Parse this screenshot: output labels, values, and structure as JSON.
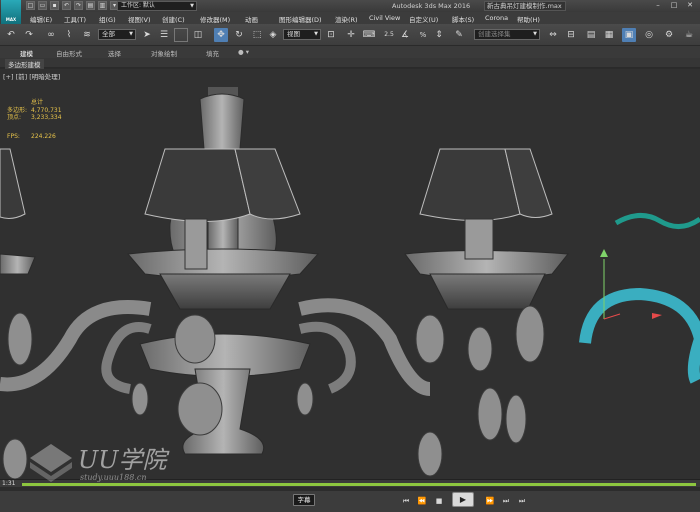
{
  "app": {
    "logo_text": "MAX",
    "workspace": "工作区: 默认",
    "title": "Autodesk 3ds Max 2016",
    "file_name": "新古典吊灯建模制作.max"
  },
  "menu": [
    "编辑(E)",
    "工具(T)",
    "组(G)",
    "视图(V)",
    "创建(C)",
    "修改器(M)",
    "动画",
    "图形编辑器(D)",
    "渲染(R)",
    "Civil View",
    "自定义(U)",
    "脚本(S)",
    "Corona",
    "帮助(H)"
  ],
  "toolbar": {
    "selection_filter": "全部",
    "coord_system": "视图",
    "snap_value": "2.5",
    "percent_snap": "%",
    "named_selection": "创建选择集"
  },
  "ribbon": {
    "tabs": [
      "建模",
      "自由形式",
      "选择",
      "对象绘制",
      "填充"
    ],
    "panel": "多边形建模"
  },
  "viewport": {
    "label": "[+] [前] [明暗处理]",
    "stats": {
      "header": "总计",
      "polys_label": "多边形:",
      "polys_value": "4,770,731",
      "verts_label": "顶点:",
      "verts_value": "3,233,334",
      "fps_label": "FPS:",
      "fps_value": "224.226"
    }
  },
  "timeline": {
    "current_time": "1:31"
  },
  "player": {
    "caption_button": "字幕"
  },
  "watermark": {
    "main": "UU学院",
    "sub": "study.uuu188.cn"
  },
  "colors": {
    "timeline_progress": "#8dc63f",
    "stats_text": "#e8c44a",
    "curve_teal": "#3aaec0",
    "teal_wave": "#1f9a8c"
  }
}
